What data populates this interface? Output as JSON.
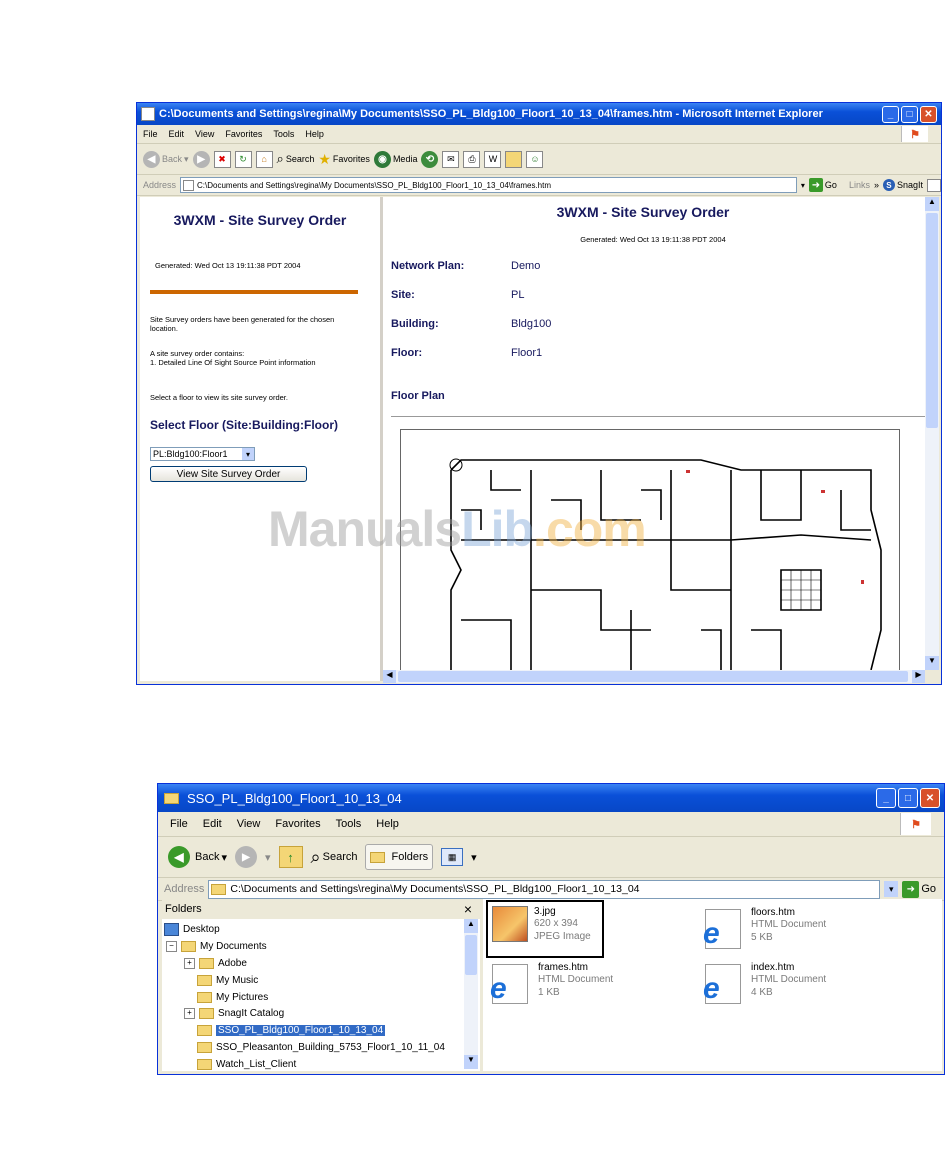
{
  "ie": {
    "title": "C:\\Documents and Settings\\regina\\My Documents\\SSO_PL_Bldg100_Floor1_10_13_04\\frames.htm - Microsoft Internet Explorer",
    "menu": [
      "File",
      "Edit",
      "View",
      "Favorites",
      "Tools",
      "Help"
    ],
    "toolbar": {
      "back": "Back",
      "search": "Search",
      "favorites": "Favorites",
      "media": "Media"
    },
    "address_label": "Address",
    "address": "C:\\Documents and Settings\\regina\\My Documents\\SSO_PL_Bldg100_Floor1_10_13_04\\frames.htm",
    "go": "Go",
    "links": "Links",
    "snagit": "SnagIt",
    "left": {
      "title": "3WXM - Site Survey Order",
      "generated": "Generated: Wed Oct 13 19:11:38 PDT 2004",
      "para1": "Site Survey orders have been generated for the chosen location.",
      "para2_l1": "A site survey order contains:",
      "para2_l2": "1. Detailed Line Of Sight Source Point information",
      "para3": "Select a floor to view its site survey order.",
      "select_heading": "Select Floor (Site:Building:Floor)",
      "select_value": "PL:Bldg100:Floor1",
      "view_button": "View Site Survey Order",
      "accent": "#cc6600"
    },
    "right": {
      "title": "3WXM - Site Survey Order",
      "generated": "Generated: Wed Oct 13 19:11:38 PDT 2004",
      "rows": [
        {
          "label": "Network Plan:",
          "value": "Demo"
        },
        {
          "label": "Site:",
          "value": "PL"
        },
        {
          "label": "Building:",
          "value": "Bldg100"
        },
        {
          "label": "Floor:",
          "value": "Floor1"
        }
      ],
      "floor_plan": "Floor Plan"
    }
  },
  "explorer": {
    "title": "SSO_PL_Bldg100_Floor1_10_13_04",
    "menu": [
      "File",
      "Edit",
      "View",
      "Favorites",
      "Tools",
      "Help"
    ],
    "toolbar": {
      "back": "Back",
      "search": "Search",
      "folders": "Folders"
    },
    "address_label": "Address",
    "address": "C:\\Documents and Settings\\regina\\My Documents\\SSO_PL_Bldg100_Floor1_10_13_04",
    "go": "Go",
    "folders_title": "Folders",
    "close": "×",
    "tree": [
      "Desktop",
      "My Documents",
      "Adobe",
      "My Music",
      "My Pictures",
      "SnagIt Catalog",
      "SSO_PL_Bldg100_Floor1_10_13_04",
      "SSO_Pleasanton_Building_5753_Floor1_10_11_04",
      "Watch_List_Client"
    ],
    "files": [
      {
        "name": "3.jpg",
        "line1": "620 x 394",
        "line2": "JPEG Image"
      },
      {
        "name": "floors.htm",
        "line1": "HTML Document",
        "line2": "5 KB"
      },
      {
        "name": "frames.htm",
        "line1": "HTML Document",
        "line2": "1 KB"
      },
      {
        "name": "index.htm",
        "line1": "HTML Document",
        "line2": "4 KB"
      }
    ]
  },
  "watermark": {
    "part1": "Manuals",
    "part2": "Lib",
    ".com": ".com"
  }
}
